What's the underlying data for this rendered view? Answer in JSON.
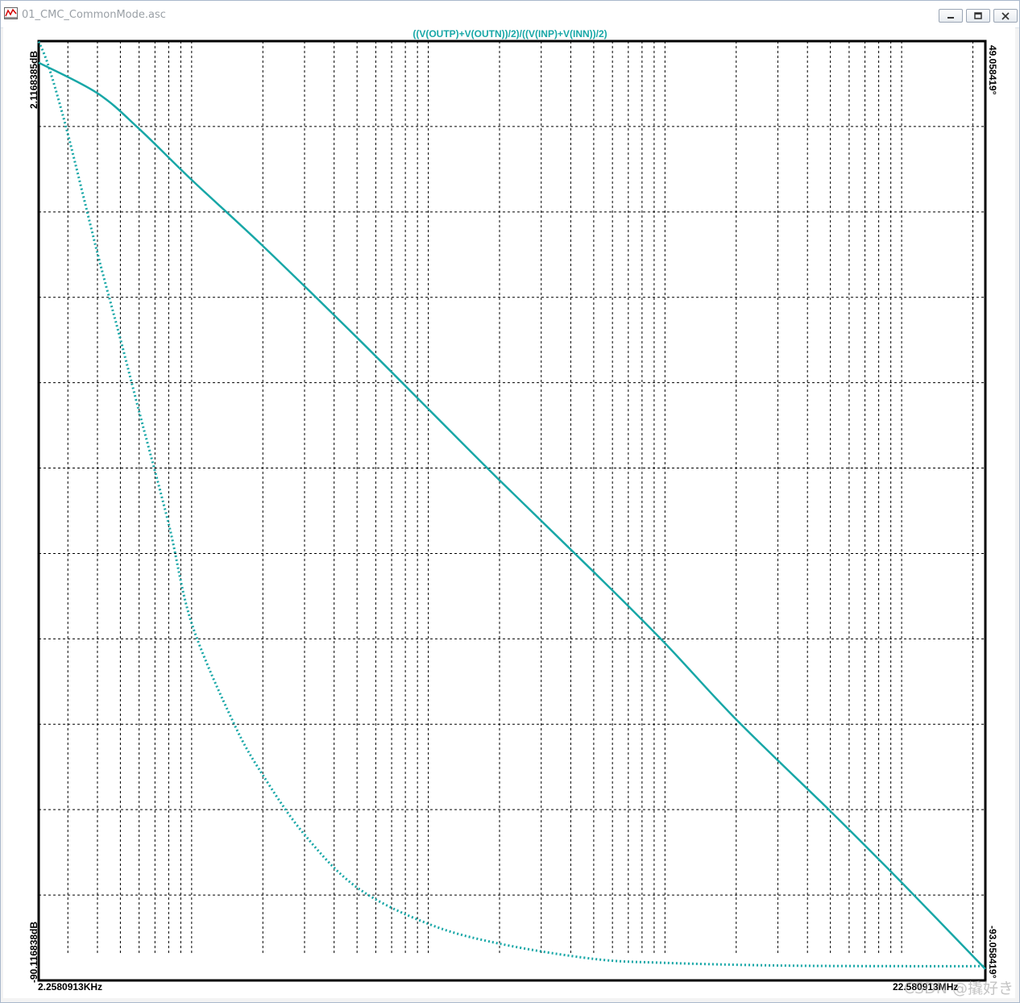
{
  "window": {
    "title": "01_CMC_CommonMode.asc",
    "buttons": {
      "minimize": "minimize-icon",
      "restore": "restore-icon",
      "close": "close-icon"
    }
  },
  "chart_data": {
    "type": "line",
    "title": "((V(OUTP)+V(OUTN))/2)/((V(INP)+V(INN))/2)",
    "x_scale": "log",
    "x_range_hz": [
      2258.0913,
      22580913
    ],
    "xlim_labels": {
      "left": "2.2580913KHz",
      "right": "22.580913MHz"
    },
    "y_left_labels": {
      "top": "2.1168385dB",
      "bottom": "-90.116838dB"
    },
    "y_right_labels": {
      "top": "49.058419°",
      "bottom": "-93.058419°"
    },
    "y_left_range_db": [
      -90.116838,
      2.1168385
    ],
    "y_right_range_deg": [
      -93.058419,
      49.058419
    ],
    "grid": true,
    "colors": {
      "trace": "#18a7a7",
      "grid": "#000000"
    },
    "series": [
      {
        "style": "solid",
        "axis": "left",
        "x": [
          2258.0913,
          4000,
          6000,
          10000,
          20000,
          50000,
          100000,
          200000,
          500000,
          1000000,
          2000000,
          5000000,
          10000000,
          22580913
        ],
        "values": [
          0,
          -3,
          -6.5,
          -11.5,
          -18,
          -27,
          -34,
          -41,
          -50,
          -57,
          -64.5,
          -73.5,
          -80.5,
          -89
        ]
      },
      {
        "style": "dotted",
        "axis": "right",
        "x": [
          2258.0913,
          2500,
          3000,
          4000,
          5000,
          6000,
          8000,
          10000,
          15000,
          20000,
          30000,
          50000,
          100000,
          200000,
          500000,
          1000000,
          3000000,
          10000000,
          22580913
        ],
        "values": [
          49,
          45,
          35,
          17,
          4,
          -7,
          -24,
          -39,
          -54,
          -62,
          -71,
          -79,
          -84.5,
          -87.5,
          -89.8,
          -90.4,
          -90.8,
          -90.9,
          -90.9
        ]
      }
    ]
  },
  "watermark": "CSDN @撬好き"
}
